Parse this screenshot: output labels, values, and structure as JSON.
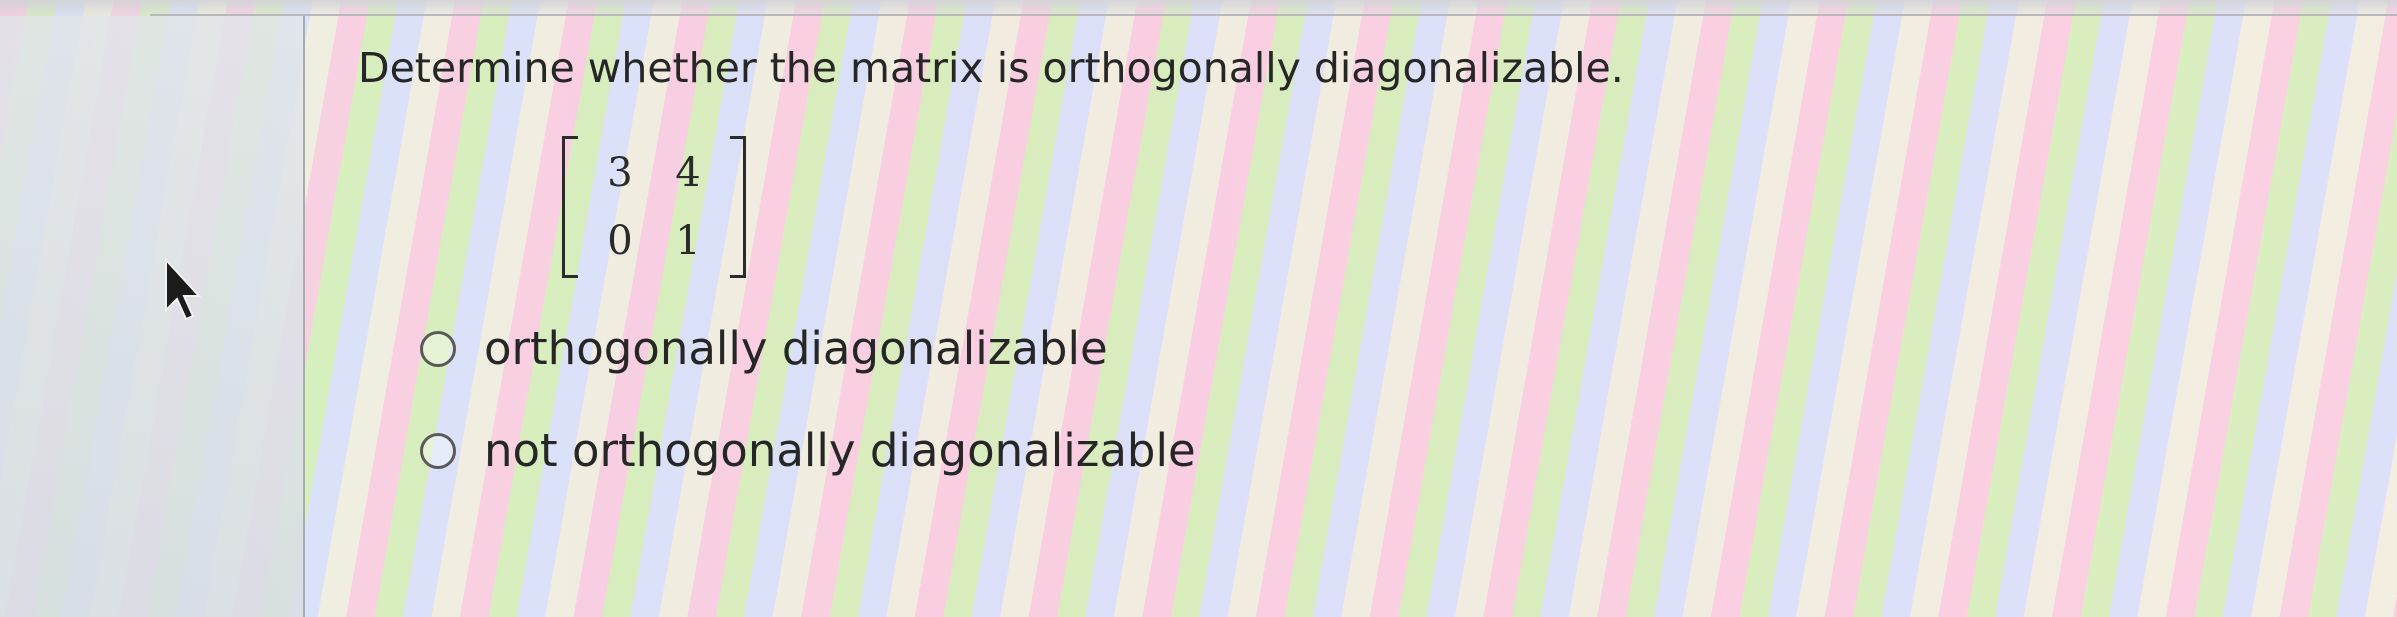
{
  "question": {
    "text": "Determine whether the matrix is orthogonally diagonalizable."
  },
  "matrix": {
    "rows": [
      [
        "3",
        "4"
      ],
      [
        "0",
        "1"
      ]
    ]
  },
  "options": [
    {
      "label": "orthogonally diagonalizable",
      "selected": false
    },
    {
      "label": "not orthogonally diagonalizable",
      "selected": false
    }
  ],
  "icons": {
    "cursor": "mouse-pointer-icon",
    "radio": "radio-button-icon"
  }
}
